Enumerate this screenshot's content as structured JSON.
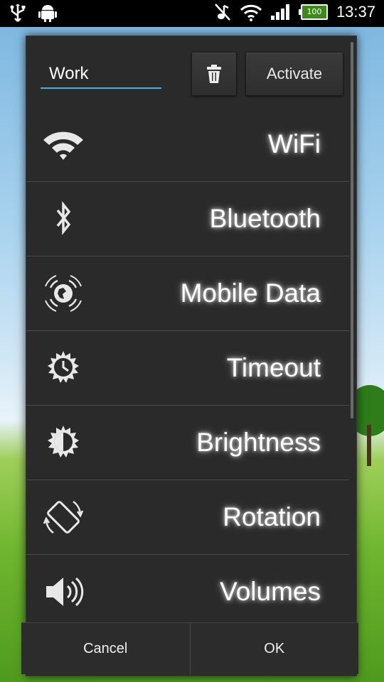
{
  "status_bar": {
    "time": "13:37",
    "battery_level": "100",
    "icons": [
      "usb-icon",
      "android-debug-icon",
      "muted-music-icon",
      "wifi-signal-icon",
      "cell-signal-icon",
      "battery-icon"
    ]
  },
  "dialog": {
    "profile_name": "Work",
    "delete_icon": "trash-icon",
    "activate_label": "Activate",
    "settings": [
      {
        "label": "WiFi",
        "icon": "wifi-icon"
      },
      {
        "label": "Bluetooth",
        "icon": "bluetooth-icon"
      },
      {
        "label": "Mobile Data",
        "icon": "mobile-data-icon"
      },
      {
        "label": "Timeout",
        "icon": "timeout-icon"
      },
      {
        "label": "Brightness",
        "icon": "brightness-icon"
      },
      {
        "label": "Rotation",
        "icon": "rotation-icon"
      },
      {
        "label": "Volumes",
        "icon": "volume-icon"
      }
    ],
    "cancel_label": "Cancel",
    "ok_label": "OK"
  }
}
